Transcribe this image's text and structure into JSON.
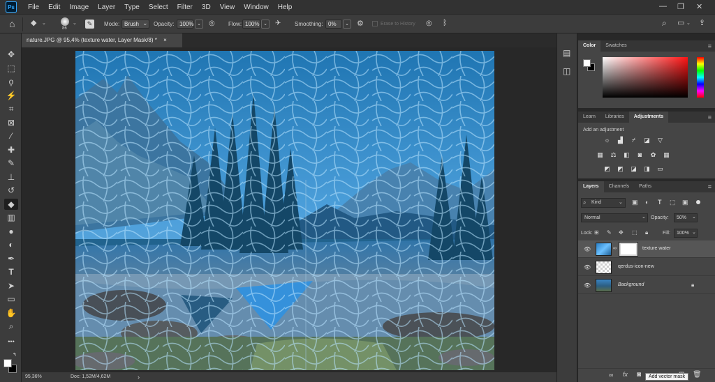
{
  "app": {
    "logo": "Ps"
  },
  "menu": [
    "File",
    "Edit",
    "Image",
    "Layer",
    "Type",
    "Select",
    "Filter",
    "3D",
    "View",
    "Window",
    "Help"
  ],
  "window_controls": {
    "minimize": "—",
    "restore": "❐",
    "close": "✕"
  },
  "options": {
    "brush_size": "86",
    "mode_label": "Mode:",
    "mode_value": "Brush",
    "opacity_label": "Opacity:",
    "opacity_value": "100%",
    "flow_label": "Flow:",
    "flow_value": "100%",
    "smoothing_label": "Smoothing:",
    "smoothing_value": "0%",
    "erase_history_label": "Erase to History"
  },
  "document": {
    "tab_title": "nature.JPG @ 95,4% (texture water, Layer Mask/8) *",
    "close": "×"
  },
  "status": {
    "zoom": "95,36%",
    "doc": "Doc: 1,52M/4,62M",
    "arrow": "›"
  },
  "color_panel": {
    "tabs": [
      "Color",
      "Swatches"
    ],
    "active": 0,
    "foreground": "#ffffff",
    "background": "#000000"
  },
  "adjust_panel": {
    "tabs": [
      "Learn",
      "Libraries",
      "Adjustments"
    ],
    "active": 2,
    "hint": "Add an adjustment"
  },
  "layers_panel": {
    "tabs": [
      "Layers",
      "Channels",
      "Paths"
    ],
    "active": 0,
    "filter_kind": "Kind",
    "blend_mode": "Normal",
    "opacity_label": "Opacity:",
    "opacity_value": "50%",
    "lock_label": "Lock:",
    "fill_label": "Fill:",
    "fill_value": "100%",
    "layers": [
      {
        "name": "texture water",
        "selected": true,
        "has_mask": true
      },
      {
        "name": "qerdus-icon-new",
        "selected": false
      },
      {
        "name": "Background",
        "selected": false,
        "locked": true
      }
    ]
  },
  "tooltip": "Add vector mask"
}
